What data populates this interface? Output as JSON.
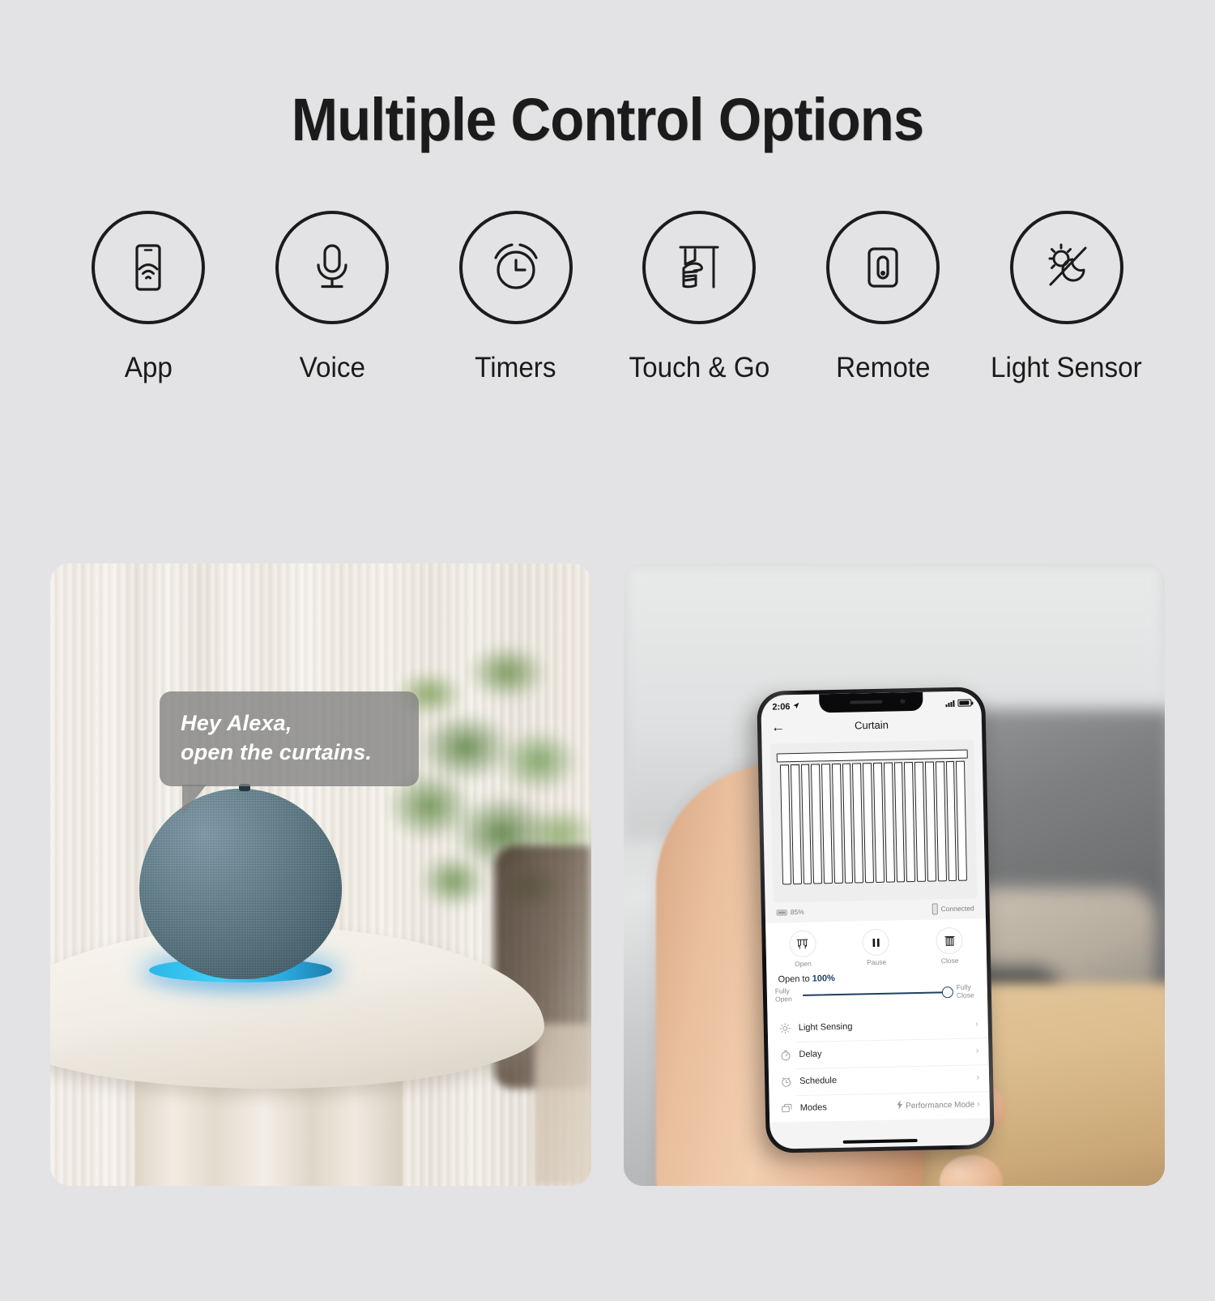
{
  "header": {
    "title": "Multiple Control Options"
  },
  "features": [
    {
      "label": "App",
      "icon": "phone-wifi-icon"
    },
    {
      "label": "Voice",
      "icon": "microphone-icon"
    },
    {
      "label": "Timers",
      "icon": "alarm-clock-icon"
    },
    {
      "label": "Touch & Go",
      "icon": "hand-pulling-curtain-icon"
    },
    {
      "label": "Remote",
      "icon": "remote-control-icon"
    },
    {
      "label": "Light Sensor",
      "icon": "sun-moon-slash-icon"
    }
  ],
  "left_photo": {
    "name": "echo-dot-on-table-photo",
    "speech_bubble": {
      "line1": "Hey Alexa,",
      "line2": "open the curtains."
    }
  },
  "right_photo": {
    "name": "hand-holding-phone-photo",
    "phone": {
      "status_bar": {
        "time": "2:06",
        "location_icon": "location-arrow-icon",
        "signal_icon": "signal-bars-icon",
        "battery_icon": "battery-icon"
      },
      "nav": {
        "back_icon": "back-arrow-icon",
        "title": "Curtain"
      },
      "device_status": {
        "battery_percent": "85%",
        "connection": "Connected"
      },
      "controls": [
        {
          "label": "Open",
          "icon": "curtain-open-icon"
        },
        {
          "label": "Pause",
          "icon": "pause-icon"
        },
        {
          "label": "Close",
          "icon": "curtain-close-icon"
        }
      ],
      "slider": {
        "heading_prefix": "Open to ",
        "heading_value": "100%",
        "left_label_1": "Fully",
        "left_label_2": "Open",
        "right_label_1": "Fully",
        "right_label_2": "Close",
        "position_percent": 100
      },
      "list_rows": [
        {
          "label": "Light Sensing",
          "icon": "sun-icon",
          "value": ""
        },
        {
          "label": "Delay",
          "icon": "stopwatch-icon",
          "value": ""
        },
        {
          "label": "Schedule",
          "icon": "clock-icon",
          "value": ""
        },
        {
          "label": "Modes",
          "icon": "modes-icon",
          "value": "Performance Mode"
        }
      ],
      "chevron": "›"
    }
  },
  "colors": {
    "background": "#e3e3e5",
    "title": "#1b1b1b",
    "icon_stroke": "#1b1b1b",
    "bubble_bg": "rgba(128,128,128,0.78)",
    "accent_blue": "#1f3f63",
    "echo_body": "#5a7b8c",
    "echo_ring": "#2bb6e8"
  }
}
